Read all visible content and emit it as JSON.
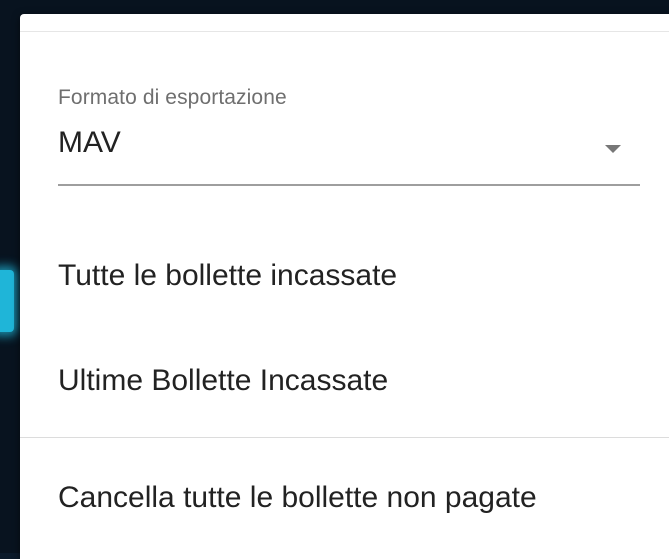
{
  "export_format": {
    "label": "Formato di esportazione",
    "selected_value": "MAV"
  },
  "menu": {
    "items": [
      {
        "label": "Tutte le bollette incassate"
      },
      {
        "label": "Ultime Bollette Incassate"
      },
      {
        "label": "Cancella tutte le bollette non pagate"
      }
    ]
  },
  "icons": {
    "dropdown": "chevron-down-icon"
  },
  "colors": {
    "accent_glow": "#1fb5d8",
    "panel_background": "#ffffff"
  }
}
